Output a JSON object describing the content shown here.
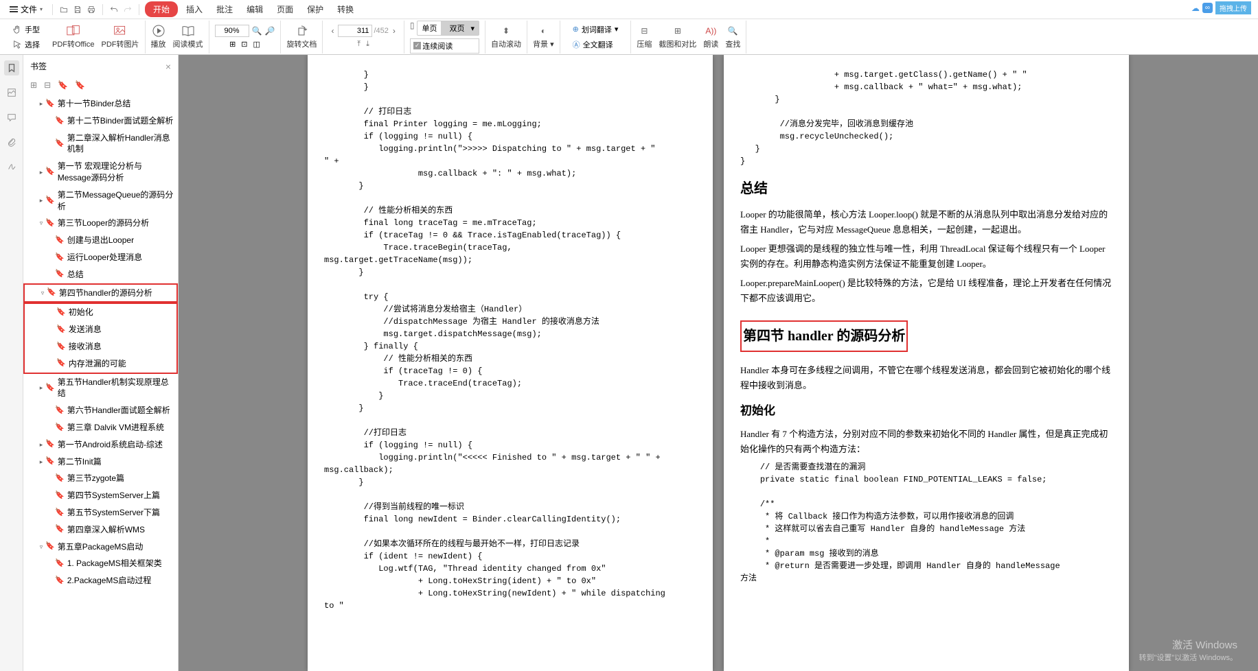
{
  "topbar": {
    "file": "文件",
    "start": "开始",
    "menu": [
      "插入",
      "批注",
      "编辑",
      "页面",
      "保护",
      "转换"
    ],
    "cloud_upload": "拖拽上传"
  },
  "ribbon": {
    "hand": "手型",
    "select": "选择",
    "pdf_office": "PDF转Office",
    "pdf_image": "PDF转图片",
    "play": "播放",
    "read_mode": "阅读模式",
    "zoom": "90%",
    "rotate": "旋转文档",
    "page_current": "311",
    "page_total": "/452",
    "single_page": "单页",
    "double_page": "双页",
    "continuous": "连续阅读",
    "auto_scroll": "自动滚动",
    "background": "背景",
    "word_trans": "划词翻译",
    "full_trans": "全文翻译",
    "compress": "压缩",
    "screenshot": "截图和对比",
    "read_aloud": "朗读",
    "find": "查找"
  },
  "bookmarks": {
    "title": "书签",
    "items": [
      {
        "text": "第十一节Binder总结",
        "level": 1,
        "expand": "▸"
      },
      {
        "text": "第十二节Binder面试题全解析",
        "level": 2,
        "expand": ""
      },
      {
        "text": "第二章深入解析Handler消息机制",
        "level": 2,
        "expand": ""
      },
      {
        "text": "第一节 宏观理论分析与Message源码分析",
        "level": 1,
        "expand": "▸"
      },
      {
        "text": "第二节MessageQueue的源码分析",
        "level": 1,
        "expand": "▸"
      },
      {
        "text": "第三节Looper的源码分析",
        "level": 1,
        "expand": "▿"
      },
      {
        "text": "创建与退出Looper",
        "level": 2,
        "expand": ""
      },
      {
        "text": "运行Looper处理消息",
        "level": 2,
        "expand": ""
      },
      {
        "text": "总结",
        "level": 2,
        "expand": ""
      },
      {
        "text": "第四节handler的源码分析",
        "level": 1,
        "expand": "▿",
        "red": true
      },
      {
        "text": "初始化",
        "level": 2,
        "expand": "",
        "redgroup": true
      },
      {
        "text": "发送消息",
        "level": 2,
        "expand": "",
        "redgroup": true
      },
      {
        "text": "接收消息",
        "level": 2,
        "expand": "",
        "redgroup": true
      },
      {
        "text": "内存泄漏的可能",
        "level": 2,
        "expand": "",
        "redgroup": true
      },
      {
        "text": "第五节Handler机制实现原理总结",
        "level": 1,
        "expand": "▸"
      },
      {
        "text": "第六节Handler面试题全解析",
        "level": 2,
        "expand": ""
      },
      {
        "text": "第三章 Dalvik VM进程系统",
        "level": 2,
        "expand": ""
      },
      {
        "text": "第一节Android系统启动-综述",
        "level": 1,
        "expand": "▸"
      },
      {
        "text": "第二节Init篇",
        "level": 1,
        "expand": "▸"
      },
      {
        "text": "第三节zygote篇",
        "level": 2,
        "expand": ""
      },
      {
        "text": "第四节SystemServer上篇",
        "level": 2,
        "expand": ""
      },
      {
        "text": "第五节SystemServer下篇",
        "level": 2,
        "expand": ""
      },
      {
        "text": "第四章深入解析WMS",
        "level": 2,
        "expand": ""
      },
      {
        "text": "第五章PackageMS启动",
        "level": 1,
        "expand": "▿"
      },
      {
        "text": "1. PackageMS相关框架类",
        "level": 2,
        "expand": ""
      },
      {
        "text": "2.PackageMS启动过程",
        "level": 2,
        "expand": ""
      }
    ]
  },
  "page_left": {
    "code": "        }\n        }\n\n        // 打印日志\n        final Printer logging = me.mLogging;\n        if (logging != null) {\n           logging.println(\">>>>> Dispatching to \" + msg.target + \"\n\" +\n                   msg.callback + \": \" + msg.what);\n       }\n\n        // 性能分析相关的东西\n        final long traceTag = me.mTraceTag;\n        if (traceTag != 0 && Trace.isTagEnabled(traceTag)) {\n            Trace.traceBegin(traceTag,\nmsg.target.getTraceName(msg));\n       }\n\n        try {\n            //尝试将消息分发给宿主（Handler）\n            //dispatchMessage 为宿主 Handler 的接收消息方法\n            msg.target.dispatchMessage(msg);\n        } finally {\n            // 性能分析相关的东西\n            if (traceTag != 0) {\n               Trace.traceEnd(traceTag);\n           }\n       }\n\n        //打印日志\n        if (logging != null) {\n           logging.println(\"<<<<< Finished to \" + msg.target + \" \" +\nmsg.callback);\n       }\n\n        //得到当前线程的唯一标识\n        final long newIdent = Binder.clearCallingIdentity();\n\n        //如果本次循环所在的线程与最开始不一样，打印日志记录\n        if (ident != newIdent) {\n           Log.wtf(TAG, \"Thread identity changed from 0x\"\n                   + Long.toHexString(ident) + \" to 0x\"\n                   + Long.toHexString(newIdent) + \" while dispatching\nto \""
  },
  "page_right": {
    "code1": "                   + msg.target.getClass().getName() + \" \"\n                   + msg.callback + \" what=\" + msg.what);\n       }\n\n        //消息分发完毕，回收消息到缓存池\n        msg.recycleUnchecked();\n   }\n}",
    "h_summary": "总结",
    "p1": "Looper 的功能很简单，核心方法 Looper.loop() 就是不断的从消息队列中取出消息分发给对应的宿主 Handler，它与对应 MessageQueue 息息相关，一起创建，一起退出。",
    "p2": "Looper 更想强调的是线程的独立性与唯一性，利用 ThreadLocal 保证每个线程只有一个 Looper 实例的存在。利用静态构造实例方法保证不能重复创建 Looper。",
    "p3": "Looper.prepareMainLooper() 是比较特殊的方法，它是给 UI 线程准备，理论上开发者在任何情况下都不应该调用它。",
    "h_section4": "第四节 handler 的源码分析",
    "p4": "Handler 本身可在多线程之间调用，不管它在哪个线程发送消息，都会回到它被初始化的哪个线程中接收到消息。",
    "h_init": "初始化",
    "p5": "Handler 有 7 个构造方法，分别对应不同的参数来初始化不同的 Handler 属性，但是真正完成初始化操作的只有两个构造方法：",
    "code2": "    // 是否需要查找潜在的漏洞\n    private static final boolean FIND_POTENTIAL_LEAKS = false;\n\n    /**\n     * 将 Callback 接口作为构造方法参数，可以用作接收消息的回调\n     * 这样就可以省去自己重写 Handler 自身的 handleMessage 方法\n     *\n     * @param msg 接收到的消息\n     * @return 是否需要进一步处理，即调用 Handler 自身的 handleMessage\n方法"
  },
  "watermark": {
    "l1": "激活 Windows",
    "l2": "转到\"设置\"以激活 Windows。"
  }
}
